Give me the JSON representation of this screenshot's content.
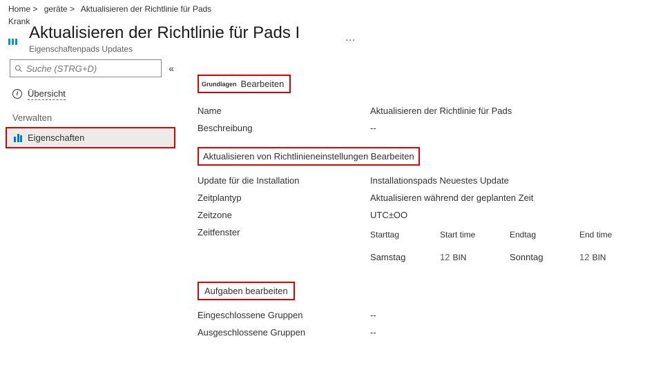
{
  "breadcrumb": {
    "home": "Home >",
    "devices": "geräte >",
    "current": "Aktualisieren der Richtlinie für Pads"
  },
  "brand": "Krank",
  "page": {
    "title": "Aktualisieren der Richtlinie für Pads I",
    "subtitle": "Eigenschaftenpads Updates",
    "more": "…"
  },
  "sidebar": {
    "search_placeholder": "Suche (STRG+D)",
    "collapse": "«",
    "overview": "Übersicht",
    "manage_header": "Verwalten",
    "properties": "Eigenschaften"
  },
  "sections": {
    "basics_small": "Grundlagen",
    "basics_edit": "Bearbeiten",
    "settings_heading": "Aktualisieren von Richtlinieneinstellungen Bearbeiten",
    "tasks_heading": "Aufgaben bearbeiten"
  },
  "basics": {
    "name_label": "Name",
    "name_value": "Aktualisieren der Richtlinie für Pads",
    "desc_label": "Beschreibung",
    "desc_value": "--"
  },
  "settings": {
    "update_label": "Update für die Installation",
    "update_value": "Installationspads Neuestes Update",
    "sched_label": "Zeitplantyp",
    "sched_value": "Aktualisieren während der geplanten Zeit",
    "tz_label": "Zeitzone",
    "tz_value": "UTC±OO",
    "window_label": "Zeitfenster",
    "tw": {
      "startday_h": "Starttag",
      "starttime_h": "Start time",
      "endday_h": "Endtag",
      "endtime_h": "End time",
      "startday": "Samstag",
      "start_n": "12",
      "start_u": "BIN",
      "endday": "Sonntag",
      "end_n": "12",
      "end_u": "BIN"
    }
  },
  "groups": {
    "included_label": "Eingeschlossene Gruppen",
    "included_value": "--",
    "excluded_label": "Ausgeschlossene Gruppen",
    "excluded_value": "--"
  }
}
